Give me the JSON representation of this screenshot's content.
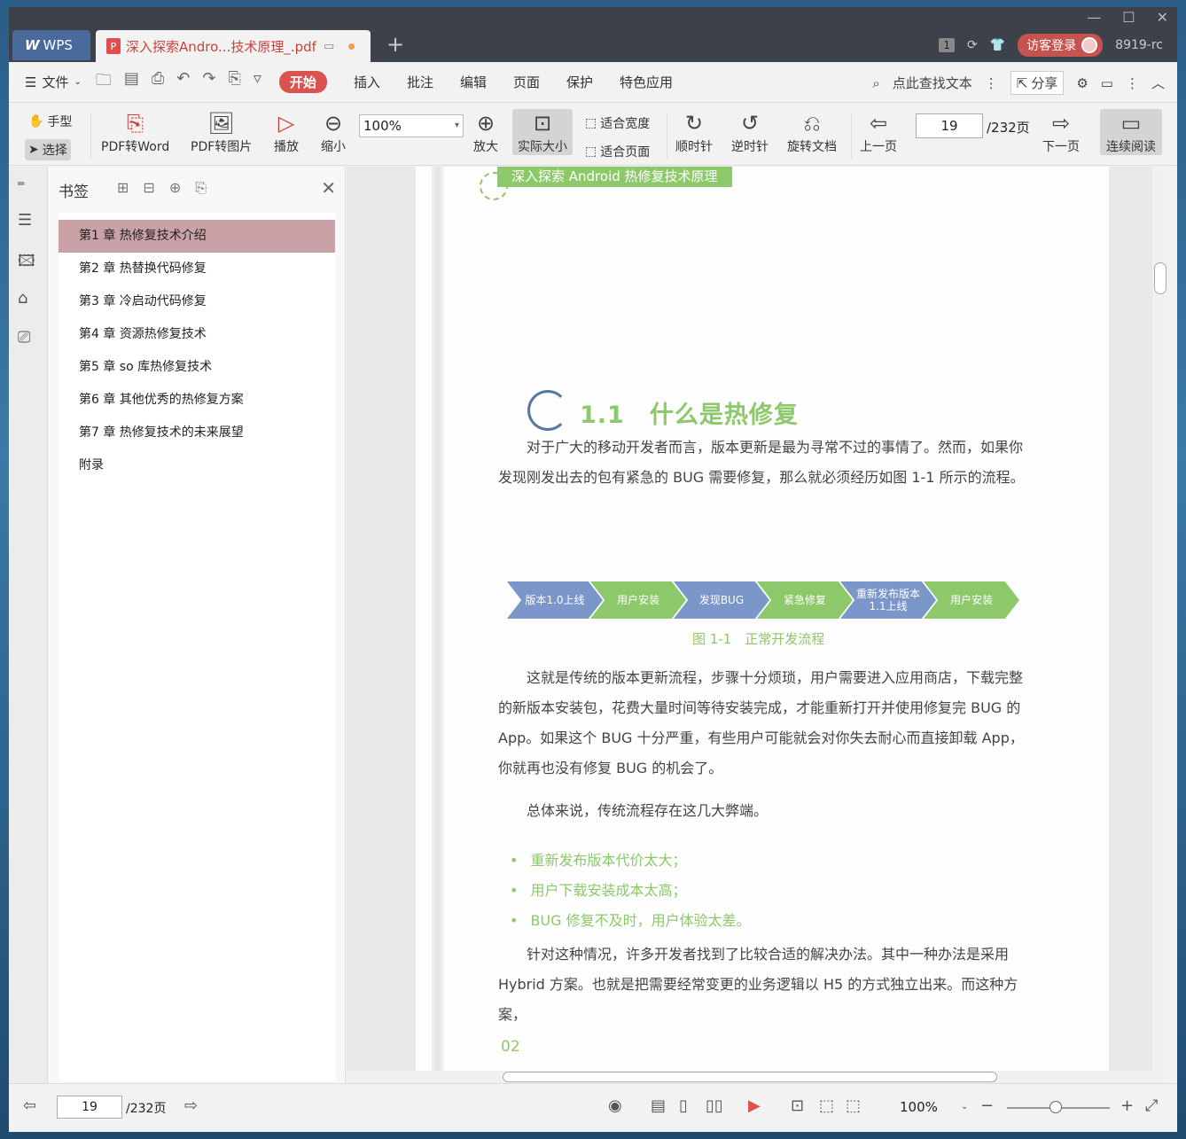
{
  "titlebar": {
    "app_tab": "WPS",
    "doc_tab_title": "深入探索Andro...技术原理_.pdf",
    "badge_count": "1",
    "login_label": "访客登录",
    "user_label": "8919-rc"
  },
  "menu": {
    "file": "文件",
    "tabs": [
      "开始",
      "插入",
      "批注",
      "编辑",
      "页面",
      "保护",
      "特色应用"
    ],
    "search": "点此查找文本",
    "share": "分享"
  },
  "toolbar": {
    "hand": "手型",
    "select": "选择",
    "pdf_to_word": "PDF转Word",
    "pdf_to_image": "PDF转图片",
    "play": "播放",
    "zoom_out": "缩小",
    "zoom_value": "100%",
    "zoom_in": "放大",
    "actual_size": "实际大小",
    "fit_width": "适合宽度",
    "fit_page": "适合页面",
    "clockwise": "顺时针",
    "counterclockwise": "逆时针",
    "rotate_doc": "旋转文档",
    "prev_page": "上一页",
    "page_value": "19",
    "page_total": "/232页",
    "next_page": "下一页",
    "continuous": "连续阅读"
  },
  "bookmarks": {
    "title": "书签",
    "items": [
      "第1 章 热修复技术介绍",
      "第2 章 热替换代码修复",
      "第3 章 冷启动代码修复",
      "第4 章 资源热修复技术",
      "第5 章 so 库热修复技术",
      "第6 章 其他优秀的热修复方案",
      "第7 章 热修复技术的未来展望",
      "附录"
    ]
  },
  "document": {
    "header": "深入探索 Android 热修复技术原理",
    "section_title": "1.1　什么是热修复",
    "para1": "　　对于广大的移动开发者而言，版本更新是最为寻常不过的事情了。然而，如果你发现刚发出去的包有紧急的 BUG 需要修复，那么就必须经历如图 1-1 所示的流程。",
    "flow": [
      "版本1.0上线",
      "用户安装",
      "发现BUG",
      "紧急修复",
      "重新发布版本1.1上线",
      "用户安装"
    ],
    "figure_caption": "图 1-1　正常开发流程",
    "para2": "　　这就是传统的版本更新流程，步骤十分烦琐，用户需要进入应用商店，下载完整的新版本安装包，花费大量时间等待安装完成，才能重新打开并使用修复完 BUG 的 App。如果这个 BUG 十分严重，有些用户可能就会对你失去耐心而直接卸载 App，你就再也没有修复 BUG 的机会了。",
    "para3": "　　总体来说，传统流程存在这几大弊端。",
    "bullets": [
      "重新发布版本代价太大；",
      "用户下载安装成本太高；",
      "BUG 修复不及时，用户体验太差。"
    ],
    "para4": "　　针对这种情况，许多开发者找到了比较合适的解决办法。其中一种办法是采用 Hybrid 方案。也就是把需要经常变更的业务逻辑以 H5 的方式独立出来。而这种方案，",
    "page_number": "02"
  },
  "statusbar": {
    "page_value": "19",
    "page_total": "/232页",
    "zoom": "100%"
  },
  "colors": {
    "accent": "#d9534f",
    "green": "#8dc86a",
    "blue": "#7b96c9"
  }
}
